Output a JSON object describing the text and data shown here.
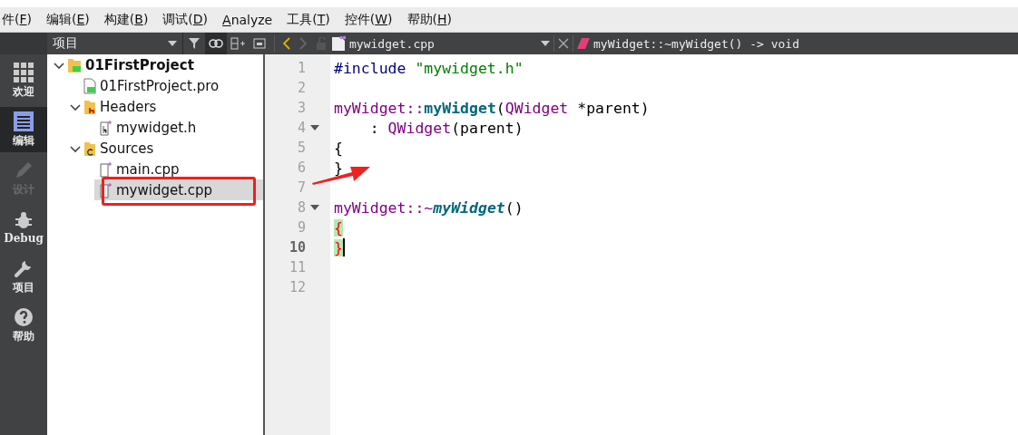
{
  "menu_bar": [
    {
      "before": "件(",
      "key": "F",
      "after": ")"
    },
    {
      "before": "编辑(",
      "key": "E",
      "after": ")"
    },
    {
      "before": "构建(",
      "key": "B",
      "after": ")"
    },
    {
      "before": "调试(",
      "key": "D",
      "after": ")"
    },
    {
      "key": "A",
      "after": "nalyze"
    },
    {
      "before": "工具(",
      "key": "T",
      "after": ")"
    },
    {
      "before": "控件(",
      "key": "W",
      "after": ")"
    },
    {
      "before": "帮助(",
      "key": "H",
      "after": ")"
    }
  ],
  "mode_bar": [
    {
      "label": "欢迎",
      "selected": false,
      "disabled": false
    },
    {
      "label": "编辑",
      "selected": true,
      "disabled": false
    },
    {
      "label": "设计",
      "selected": false,
      "disabled": true
    },
    {
      "label": "Debug",
      "selected": false,
      "disabled": false
    },
    {
      "label": "项目",
      "selected": false,
      "disabled": false
    },
    {
      "label": "帮助",
      "selected": false,
      "disabled": false
    }
  ],
  "project_pane": {
    "view_selector": "项目",
    "sync_on": true
  },
  "editor_toolbar": {
    "back_enabled": true,
    "forward_enabled": false,
    "file": "mywidget.cpp",
    "symbol": "myWidget::~myWidget() -> void"
  },
  "project_tree": [
    {
      "label": "01FirstProject",
      "kind": "project",
      "expanded": true,
      "selected": false,
      "children": [
        {
          "label": "01FirstProject.pro",
          "kind": "pro",
          "selected": false
        },
        {
          "label": "Headers",
          "kind": "headers",
          "expanded": true,
          "selected": false,
          "children": [
            {
              "label": "mywidget.h",
              "kind": "header",
              "selected": false
            }
          ]
        },
        {
          "label": "Sources",
          "kind": "sources",
          "expanded": true,
          "selected": false,
          "children": [
            {
              "label": "main.cpp",
              "kind": "source",
              "selected": false
            },
            {
              "label": "mywidget.cpp",
              "kind": "source",
              "selected": true
            }
          ]
        }
      ]
    }
  ],
  "code_lines": [
    {
      "number": "1",
      "fold": false,
      "current": false,
      "tokens": [
        {
          "kind": "preproc",
          "text": "#include"
        },
        {
          "kind": "string",
          "text": "\"mywidget.h\""
        }
      ]
    },
    {
      "number": "2",
      "fold": false,
      "current": false
    },
    {
      "number": "3",
      "fold": false,
      "current": false,
      "tokens": [
        {
          "kind": "type",
          "text": "myWidget::"
        },
        {
          "kind": "function",
          "text": "myWidget"
        },
        {
          "kind": "plain",
          "text": "("
        },
        {
          "kind": "type",
          "text": "QWidget"
        },
        {
          "kind": "plain",
          "text": " *parent)"
        }
      ]
    },
    {
      "number": "4",
      "fold": true,
      "current": false,
      "tokens": [
        {
          "kind": "plain",
          "text": "    : "
        },
        {
          "kind": "type",
          "text": "QWidget"
        },
        {
          "kind": "plain",
          "text": "(parent)"
        }
      ]
    },
    {
      "number": "5",
      "fold": false,
      "current": false,
      "tokens": [
        {
          "kind": "plain",
          "text": "{"
        }
      ]
    },
    {
      "number": "6",
      "fold": false,
      "current": false,
      "tokens": [
        {
          "kind": "plain",
          "text": "}"
        }
      ]
    },
    {
      "number": "7",
      "fold": false,
      "current": false
    },
    {
      "number": "8",
      "fold": true,
      "current": false,
      "tokens": [
        {
          "kind": "type",
          "text": "myWidget::~"
        },
        {
          "kind": "destructor",
          "text": "myWidget"
        },
        {
          "kind": "plain",
          "text": "()"
        }
      ]
    },
    {
      "number": "9",
      "fold": false,
      "current": false,
      "tokens": [
        {
          "kind": "brace-match",
          "text": "{"
        }
      ]
    },
    {
      "number": "10",
      "fold": false,
      "current": true,
      "tokens": [
        {
          "kind": "brace-match",
          "text": "}"
        }
      ]
    },
    {
      "number": "11",
      "fold": false,
      "current": false
    },
    {
      "number": "12",
      "fold": false,
      "current": false
    }
  ]
}
